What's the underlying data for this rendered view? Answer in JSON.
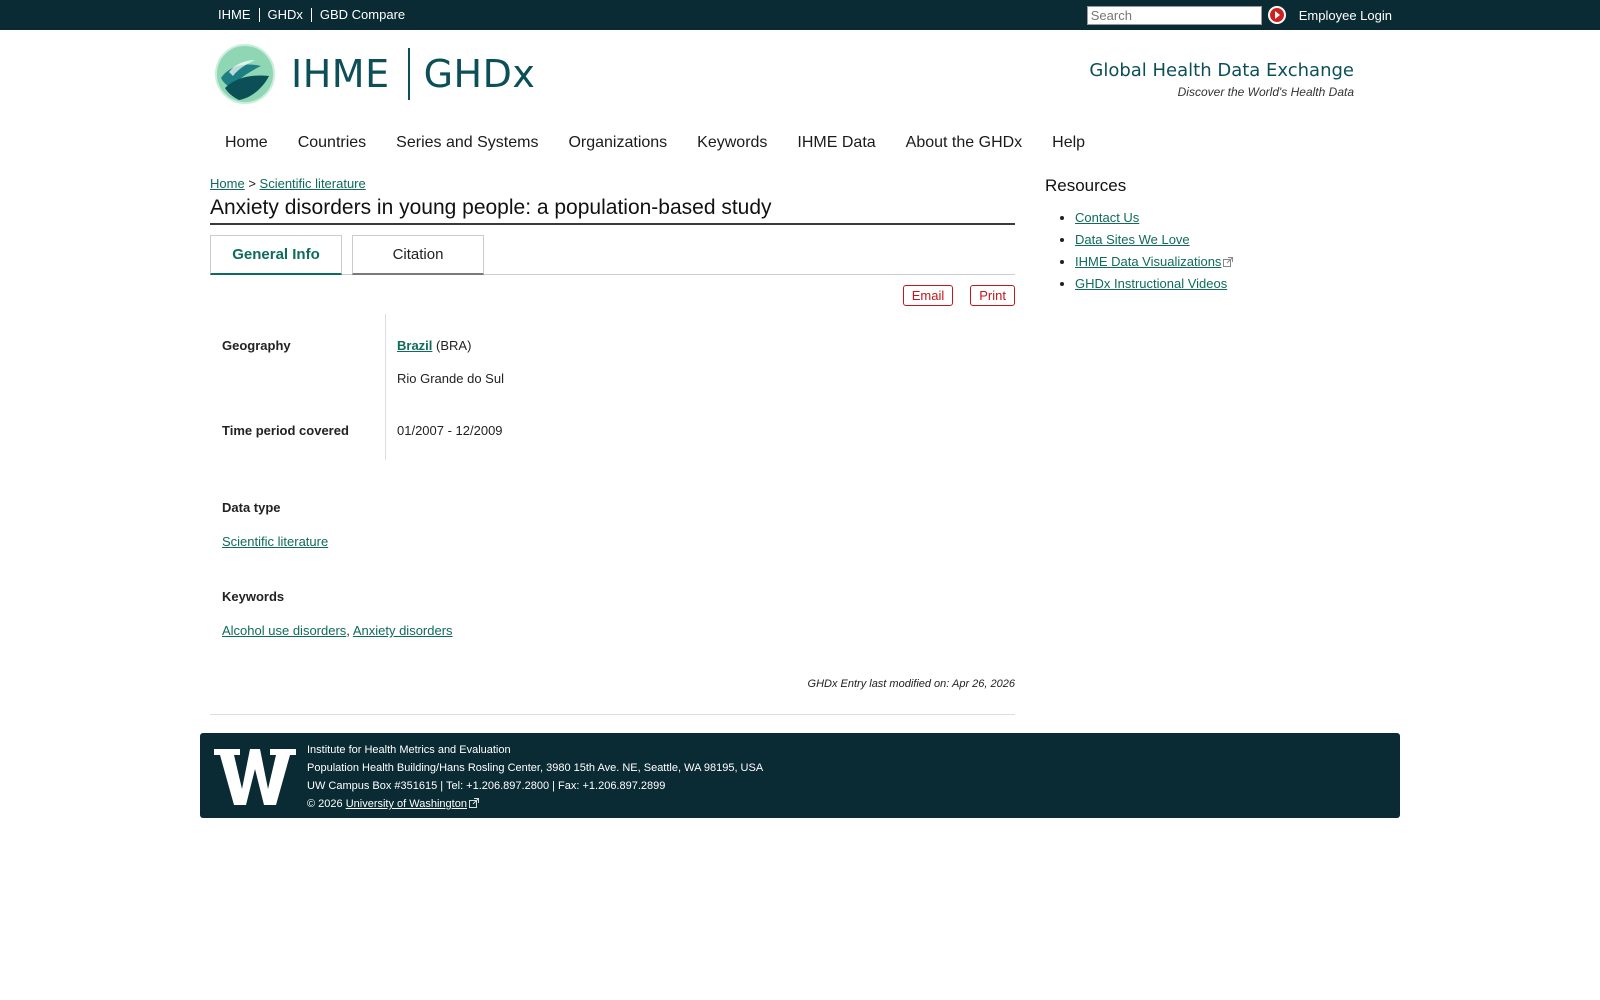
{
  "topbar": {
    "links": [
      "IHME",
      "GHDx",
      "GBD Compare"
    ],
    "search_placeholder": "Search",
    "employee_login": "Employee Login"
  },
  "header": {
    "logo_left": "IHME",
    "logo_right": "GHDx",
    "tagline_title": "Global Health Data Exchange",
    "tagline_sub": "Discover the World's Health Data"
  },
  "nav": [
    "Home",
    "Countries",
    "Series and Systems",
    "Organizations",
    "Keywords",
    "IHME Data",
    "About the GHDx",
    "Help"
  ],
  "breadcrumb": {
    "home": "Home",
    "sep": ">",
    "current": "Scientific literature"
  },
  "page_title": "Anxiety disorders in young people: a population-based study",
  "tabs": {
    "general": "General Info",
    "citation": "Citation"
  },
  "actions": {
    "email": "Email",
    "print": "Print"
  },
  "fields": {
    "geography_label": "Geography",
    "country_link": "Brazil",
    "country_code": "(BRA)",
    "region": "Rio Grande do Sul",
    "time_label": "Time period covered",
    "time_value": "01/2007 - 12/2009",
    "data_type_label": "Data type",
    "data_type_value": "Scientific literature",
    "keywords_label": "Keywords",
    "keyword_1": "Alcohol use disorders",
    "keyword_sep": ",",
    "keyword_2": "Anxiety disorders"
  },
  "modified": "GHDx Entry last modified on: Apr 26, 2026",
  "resources": {
    "title": "Resources",
    "items": [
      "Contact Us",
      "Data Sites We Love",
      "IHME Data Visualizations",
      "GHDx Instructional Videos"
    ]
  },
  "footer": {
    "line1": "Institute for Health Metrics and Evaluation",
    "line2": "Population Health Building/Hans Rosling Center, 3980 15th Ave. NE, Seattle, WA 98195, USA",
    "line3": "UW Campus Box #351615 | Tel: +1.206.897.2800 | Fax: +1.206.897.2899",
    "copyright": "© 2026",
    "uw_link": "University of Washington"
  },
  "colors": {
    "dark_teal": "#0a2b33",
    "link_green": "#0f6b5b",
    "accent_red": "#c4161c"
  }
}
